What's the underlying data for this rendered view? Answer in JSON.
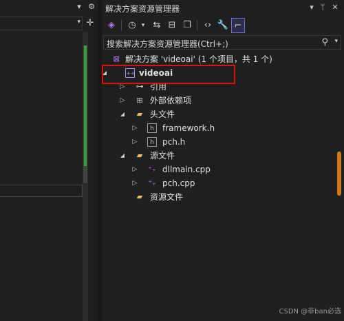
{
  "left_panel": {
    "pin_icon": "pin-icon",
    "settings_icon": "gear-icon",
    "split_icon": "split-icon"
  },
  "solution_explorer": {
    "title": "解决方案资源管理器",
    "title_buttons": [
      "▾",
      "📌",
      "✕"
    ],
    "toolbar": [
      "vs-icon",
      "clock-icon",
      "sync-icon",
      "collapse-icon",
      "copy-icon",
      "code-icon",
      "wrench-icon",
      "preview-icon"
    ],
    "search": {
      "placeholder": "搜索解决方案资源管理器(Ctrl+;)"
    },
    "tree": [
      {
        "label": "解决方案 'videoai' (1 个项目，共 1 个)",
        "icon": "solution-icon",
        "level": 0,
        "expander": ""
      },
      {
        "label": "videoai",
        "icon": "project-icon",
        "level": 0,
        "expander": "▲",
        "selected": true
      },
      {
        "label": "引用",
        "icon": "references-icon",
        "level": 1,
        "expander": "▶"
      },
      {
        "label": "外部依赖项",
        "icon": "external-deps-icon",
        "level": 1,
        "expander": "▶"
      },
      {
        "label": "头文件",
        "icon": "folder-icon",
        "level": 1,
        "expander": "▲"
      },
      {
        "label": "framework.h",
        "icon": "header-file-icon",
        "level": 2,
        "expander": "▶"
      },
      {
        "label": "pch.h",
        "icon": "header-file-icon",
        "level": 2,
        "expander": "▶"
      },
      {
        "label": "源文件",
        "icon": "folder-icon",
        "level": 1,
        "expander": "▲"
      },
      {
        "label": "dllmain.cpp",
        "icon": "cpp-file-icon",
        "level": 2,
        "expander": "▶"
      },
      {
        "label": "pch.cpp",
        "icon": "cpp-file-icon",
        "level": 2,
        "expander": "▶"
      },
      {
        "label": "资源文件",
        "icon": "folder-icon",
        "level": 1,
        "expander": ""
      }
    ]
  },
  "watermark": "CSDN @非ban必选",
  "colors": {
    "background": "#1f1f1f",
    "highlight_box": "#e01010",
    "scroll_thumb": "#d07a1e",
    "toolbar_active": "#6d6dd6"
  }
}
